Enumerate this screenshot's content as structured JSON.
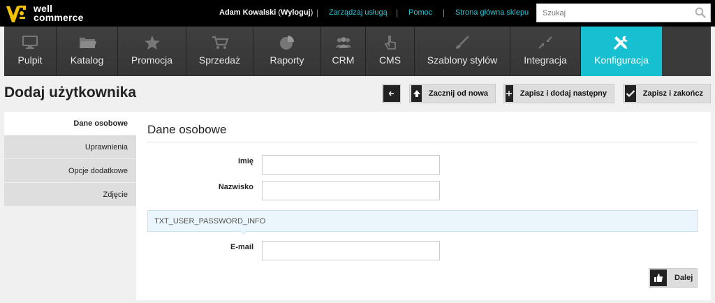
{
  "brand": {
    "line1": "well",
    "line2": "commerce"
  },
  "header": {
    "user_name": "Adam Kowalski",
    "logout_open": "(",
    "logout_label": "Wyloguj",
    "logout_close": ")",
    "links": [
      "Zarządzaj usługą",
      "Pomoc",
      "Strona główna sklepu"
    ],
    "search_placeholder": "Szukaj"
  },
  "nav": {
    "items": [
      {
        "label": "Pulpit",
        "icon": "monitor-icon"
      },
      {
        "label": "Katalog",
        "icon": "folder-icon"
      },
      {
        "label": "Promocja",
        "icon": "star-icon"
      },
      {
        "label": "Sprzedaż",
        "icon": "cart-icon"
      },
      {
        "label": "Raporty",
        "icon": "pie-chart-icon"
      },
      {
        "label": "CRM",
        "icon": "users-icon"
      },
      {
        "label": "CMS",
        "icon": "hand-pointer-icon"
      },
      {
        "label": "Szablony stylów",
        "icon": "brush-icon"
      },
      {
        "label": "Integracja",
        "icon": "compress-arrows-icon"
      },
      {
        "label": "Konfiguracja",
        "icon": "tools-icon"
      }
    ],
    "active": "Konfiguracja"
  },
  "page": {
    "title": "Dodaj użytkownika"
  },
  "toolbar": {
    "back_label": "",
    "reset_label": "Zacznij od nowa",
    "save_add_label": "Zapisz i dodaj następny",
    "save_finish_label": "Zapisz i zakończ"
  },
  "sidebar": {
    "items": [
      "Dane osobowe",
      "Uprawnienia",
      "Opcje dodatkowe",
      "Zdjęcie"
    ],
    "active": "Dane osobowe"
  },
  "form": {
    "section_title": "Dane osobowe",
    "first_name_label": "Imię",
    "first_name_value": "",
    "last_name_label": "Nazwisko",
    "last_name_value": "",
    "info_text": "TXT_USER_PASSWORD_INFO",
    "email_label": "E-mail",
    "email_value": "",
    "next_label": "Dalej"
  },
  "colors": {
    "accent": "#17c0d0",
    "link": "#27c4d6",
    "topbar": "#000000",
    "nav": "#3a3a3a"
  }
}
